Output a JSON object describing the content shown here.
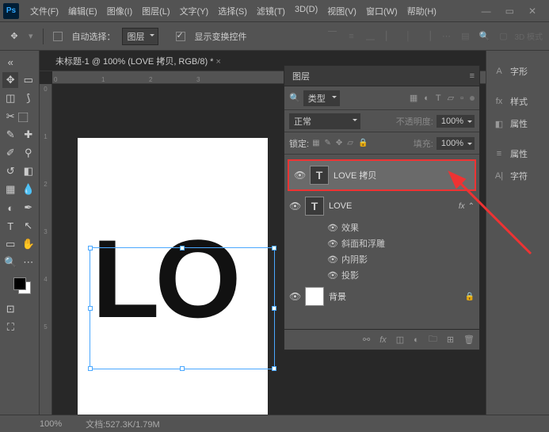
{
  "menu": [
    "文件(F)",
    "编辑(E)",
    "图像(I)",
    "图层(L)",
    "文字(Y)",
    "选择(S)",
    "滤镜(T)",
    "3D(D)",
    "视图(V)",
    "窗口(W)",
    "帮助(H)"
  ],
  "options": {
    "autoSelectLabel": "自动选择：",
    "autoSelectTarget": "图层",
    "showTransform": "显示变换控件",
    "mode3d": "3D 模式"
  },
  "document": {
    "tab": "未标题-1 @ 100% (LOVE 拷贝, RGB/8) *",
    "canvasText": "LO",
    "rulerH": [
      "0",
      "1",
      "2",
      "3"
    ],
    "rulerV": [
      "0",
      "1",
      "2",
      "3",
      "4",
      "5"
    ]
  },
  "layersPanel": {
    "title": "图层",
    "filterType": "类型",
    "blendMode": "正常",
    "opacityLabel": "不透明度:",
    "opacityValue": "100%",
    "lockLabel": "锁定:",
    "fillLabel": "填充:",
    "fillValue": "100%",
    "layers": [
      {
        "name": "LOVE 拷贝",
        "type": "T",
        "selected": true
      },
      {
        "name": "LOVE",
        "type": "T",
        "fx": true
      },
      {
        "name": "背景",
        "type": "bg",
        "locked": true
      }
    ],
    "effectsLabel": "效果",
    "effects": [
      "斜面和浮雕",
      "内阴影",
      "投影"
    ]
  },
  "dock": [
    "字形",
    "样式",
    "属性",
    "属性",
    "字符"
  ],
  "status": {
    "zoom": "100%",
    "doc": "文档:527.3K/1.79M"
  }
}
